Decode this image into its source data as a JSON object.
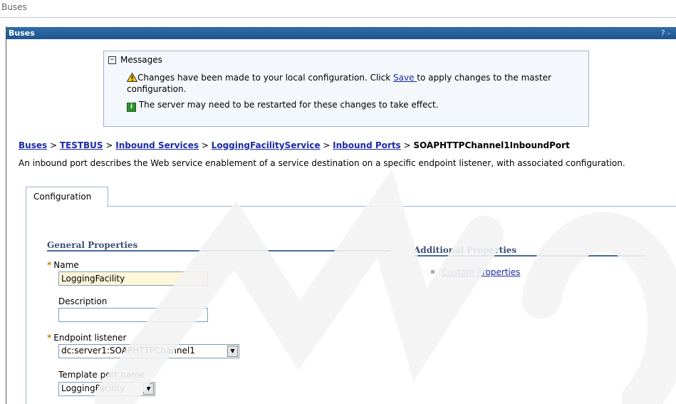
{
  "window": {
    "title": "Buses"
  },
  "portlet": {
    "title": "Buses",
    "help": "? -"
  },
  "messages": {
    "header": "Messages",
    "warning_pre": "Changes have been made to your local configuration. Click ",
    "warning_link": "Save ",
    "warning_post": "to apply changes to the master configuration.",
    "info": "The server may need to be restarted for these changes to take effect."
  },
  "breadcrumb": {
    "items": [
      "Buses",
      "TESTBUS",
      "Inbound Services",
      "LoggingFacilityService",
      "Inbound Ports"
    ],
    "separator": " > ",
    "current": "SOAPHTTPChannel1InboundPort"
  },
  "description": "An inbound port describes the Web service enablement of a service destination on a specific endpoint listener, with associated configuration.",
  "tabs": [
    {
      "label": "Configuration",
      "active": true
    }
  ],
  "general": {
    "title": "General Properties",
    "name_label": "Name",
    "name_value": "LoggingFacility",
    "description_label": "Description",
    "description_value": "",
    "endpoint_label": "Endpoint listener",
    "endpoint_value": "dc:server1:SOAPHTTPChannel1",
    "template_label": "Template port name",
    "template_value": "LoggingFacility"
  },
  "additional": {
    "title": "Additional Properties",
    "links": [
      "Custom Properties"
    ]
  },
  "colors": {
    "titlebar": "#2f6da8",
    "link": "#1a2ba8",
    "section": "#3a4f77",
    "required": "#c08800",
    "name_field_bg": "#fdf6d8"
  }
}
